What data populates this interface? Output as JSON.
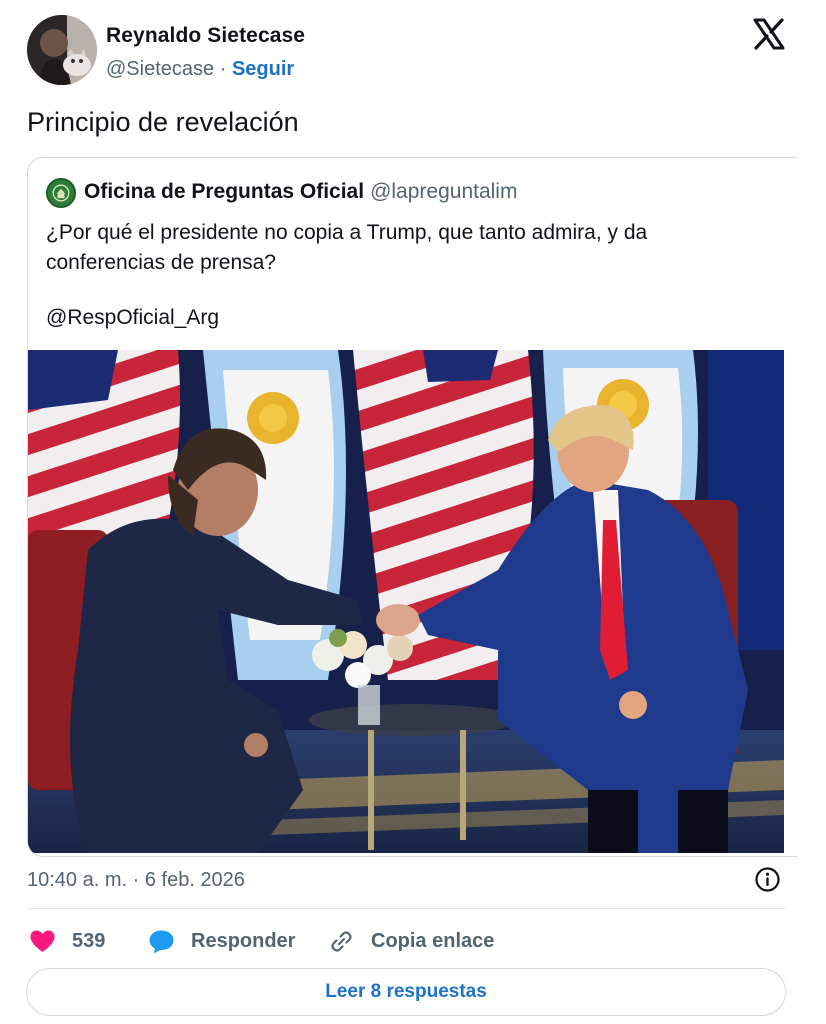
{
  "author": {
    "name": "Reynaldo Sietecase",
    "handle": "@Sietecase",
    "separator": "·",
    "follow_label": "Seguir"
  },
  "tweet": {
    "text": "Principio de revelación",
    "timestamp": "10:40 a. m. · 6 feb. 2026"
  },
  "quoted": {
    "name": "Oficina de Preguntas Oficial",
    "handle": "@lapreguntalim",
    "text_line1": "¿Por qué el presidente no copia a Trump, que tanto admira, y da",
    "text_line2": "conferencias de prensa?",
    "mention": "@RespOficial_Arg"
  },
  "actions": {
    "like_count": "539",
    "reply_label": "Responder",
    "copy_label": "Copia enlace"
  },
  "read_replies_label": "Leer 8 respuestas",
  "icons": {
    "logo": "x-logo-icon",
    "info": "info-icon",
    "like": "heart-icon",
    "reply": "speech-bubble-icon",
    "copy": "link-icon"
  },
  "colors": {
    "accent": "#1d72c8",
    "like": "#f91880",
    "reply": "#1d9bf0",
    "muted": "#536471"
  }
}
